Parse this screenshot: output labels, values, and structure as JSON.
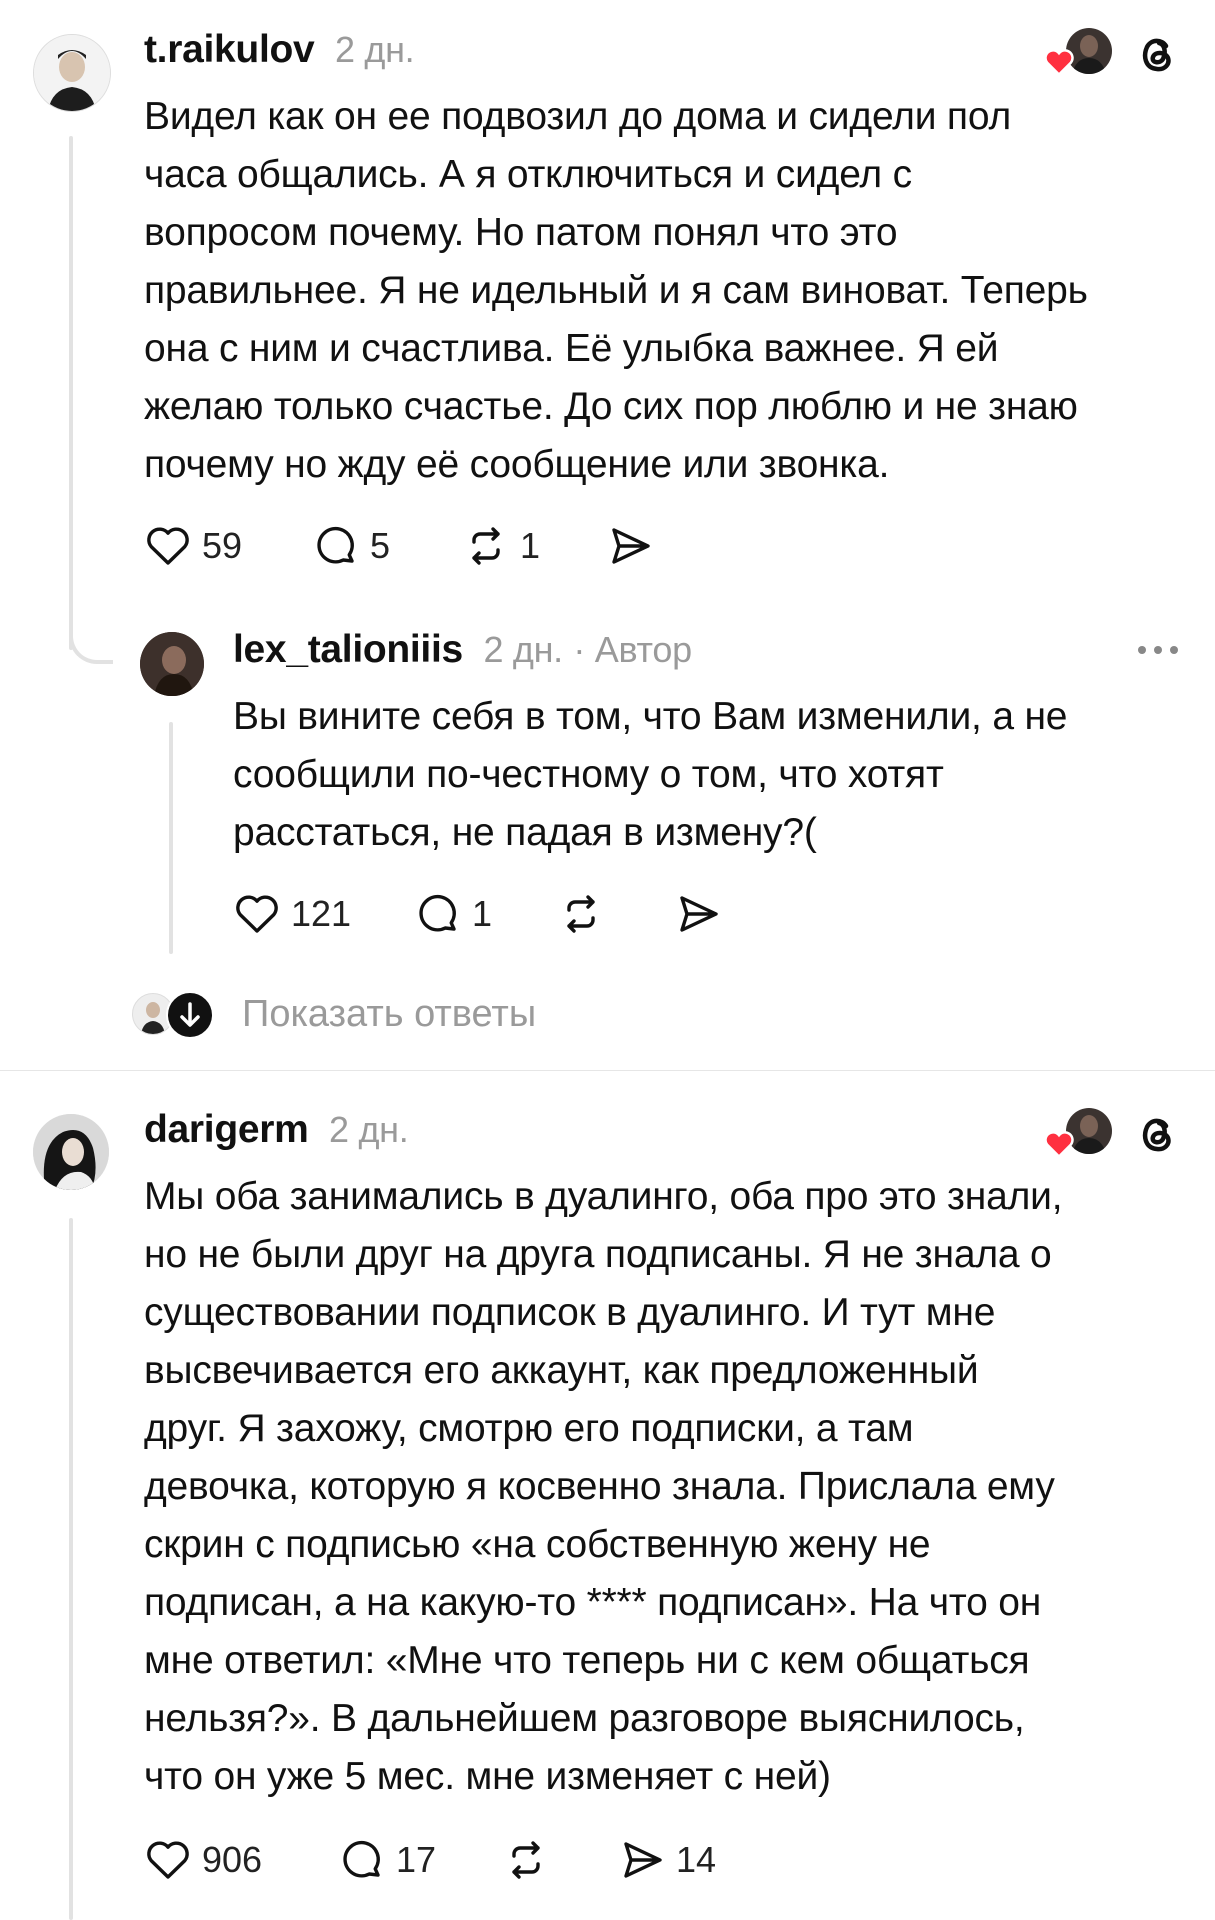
{
  "posts": [
    {
      "username": "t.raikulov",
      "time": "2 дн.",
      "text_lines": [
        "Видел как он ее подвозил до дома и сидели пол",
        "часа общались. А я отключиться и сидел с",
        "вопросом почему. Но патом понял что это",
        "правильнее. Я не идельный и я сам виноват. Теперь",
        "она с ним и счастлива. Её улыбка важнее. Я ей",
        "желаю только счастье. До сих пор люблю и не знаю",
        "почему но жду её сообщение или звонка."
      ],
      "likes": "59",
      "replies": "5",
      "reposts": "1"
    },
    {
      "username": "lex_talioniiis",
      "time": "2 дн.",
      "author_badge": "· Автор",
      "text_lines": [
        "Вы вините себя в том, что Вам изменили, а не",
        "сообщили по-честному о том, что хотят",
        "расстаться, не падая в измену?("
      ],
      "likes": "121",
      "replies": "1"
    },
    {
      "username": "darigerm",
      "time": "2 дн.",
      "text_lines": [
        "Мы оба занимались в дуалинго, оба про это знали,",
        "но не были друг на друга подписаны. Я не знала о",
        "существовании подписок в дуалинго. И тут мне",
        "высвечивается его аккаунт, как предложенный",
        "друг. Я захожу, смотрю его подписки, а там",
        "девочка, которую я косвенно знала. Прислала ему",
        "скрин с подписью «на собственную жену не",
        "подписан, а на какую-то **** подписан». На что он",
        "мне ответил: «Мне что теперь ни с кем общаться",
        "нельзя?». В дальнейшем разговоре выяснилось,",
        "что он уже 5 мес. мне изменяет с ней)"
      ],
      "likes": "906",
      "replies": "17",
      "shares": "14"
    }
  ],
  "show_replies_label": "Показать ответы",
  "colors": {
    "heart": "#ff3040",
    "line": "#e2e2e2",
    "meta": "#9a9a9a"
  }
}
